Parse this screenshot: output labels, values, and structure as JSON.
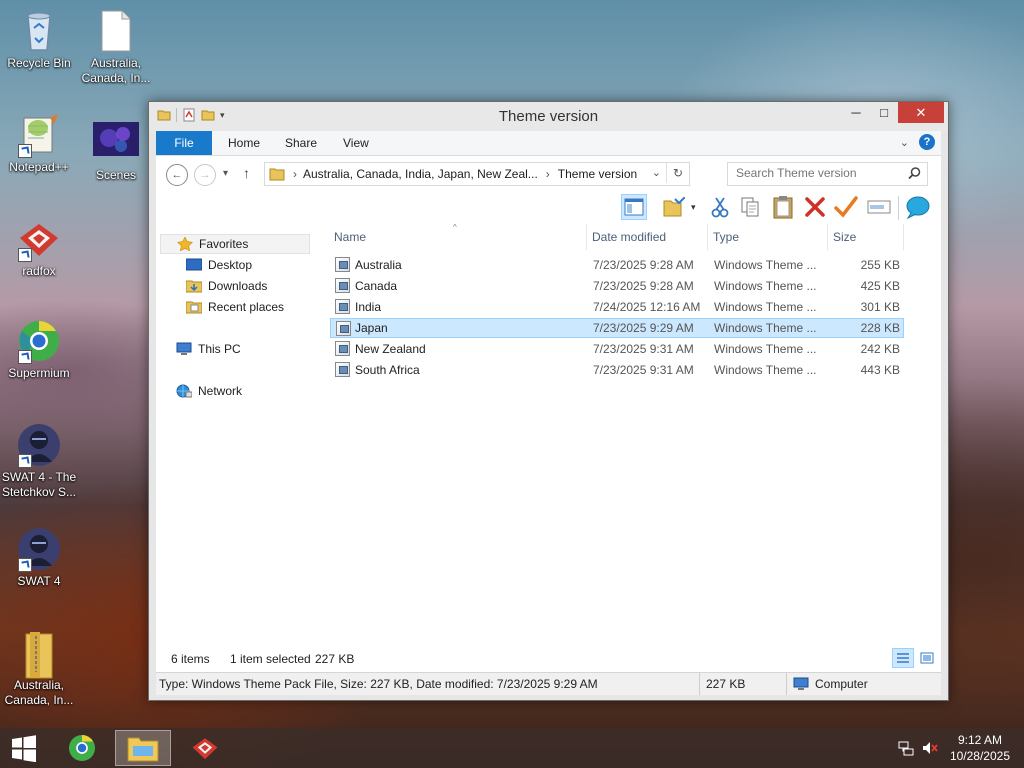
{
  "desktop": {
    "icons": [
      {
        "label": "Recycle Bin"
      },
      {
        "label": "Australia, Canada, In..."
      },
      {
        "label": "Notepad++"
      },
      {
        "label": "Scenes"
      },
      {
        "label": "radfox"
      },
      {
        "label": "Supermium"
      },
      {
        "label": "SWAT 4 - The Stetchkov S..."
      },
      {
        "label": "SWAT 4"
      },
      {
        "label": "Australia, Canada, In..."
      }
    ]
  },
  "window": {
    "title": "Theme version",
    "controls": {
      "minimize": "─",
      "maximize": "□",
      "close": "✕"
    },
    "ribbon_tabs": [
      "File",
      "Home",
      "Share",
      "View"
    ],
    "nav": {
      "back": "←",
      "forward": "→",
      "recent": "▾",
      "up": "↑"
    },
    "address": {
      "segments": [
        "Australia, Canada, India, Japan, New Zeal...",
        "Theme version"
      ],
      "separator": "›"
    },
    "search": {
      "placeholder": "Search Theme version"
    },
    "nav_pane": {
      "favorites": "Favorites",
      "favorite_items": [
        "Desktop",
        "Downloads",
        "Recent places"
      ],
      "this_pc": "This PC",
      "network": "Network"
    },
    "columns": {
      "name": "Name",
      "date": "Date modified",
      "type": "Type",
      "size": "Size"
    },
    "files": [
      {
        "name": "Australia",
        "date": "7/23/2025 9:28 AM",
        "type": "Windows Theme ...",
        "size": "255 KB",
        "selected": false
      },
      {
        "name": "Canada",
        "date": "7/23/2025 9:28 AM",
        "type": "Windows Theme ...",
        "size": "425 KB",
        "selected": false
      },
      {
        "name": "India",
        "date": "7/24/2025 12:16 AM",
        "type": "Windows Theme ...",
        "size": "301 KB",
        "selected": false
      },
      {
        "name": "Japan",
        "date": "7/23/2025 9:29 AM",
        "type": "Windows Theme ...",
        "size": "228 KB",
        "selected": true
      },
      {
        "name": "New Zealand",
        "date": "7/23/2025 9:31 AM",
        "type": "Windows Theme ...",
        "size": "242 KB",
        "selected": false
      },
      {
        "name": "South Africa",
        "date": "7/23/2025 9:31 AM",
        "type": "Windows Theme ...",
        "size": "443 KB",
        "selected": false
      }
    ],
    "status": {
      "count": "6 items",
      "selection": "1 item selected",
      "selection_size": "227 KB"
    },
    "info_bar": {
      "details": "Type: Windows Theme Pack File, Size: 227 KB, Date modified: 7/23/2025 9:29 AM",
      "size": "227 KB",
      "location": "Computer"
    }
  },
  "taskbar": {
    "time": "9:12 AM",
    "date": "10/28/2025"
  },
  "colors": {
    "accent": "#1979ca",
    "selection": "#cce8ff",
    "close_button": "#c7403a"
  }
}
